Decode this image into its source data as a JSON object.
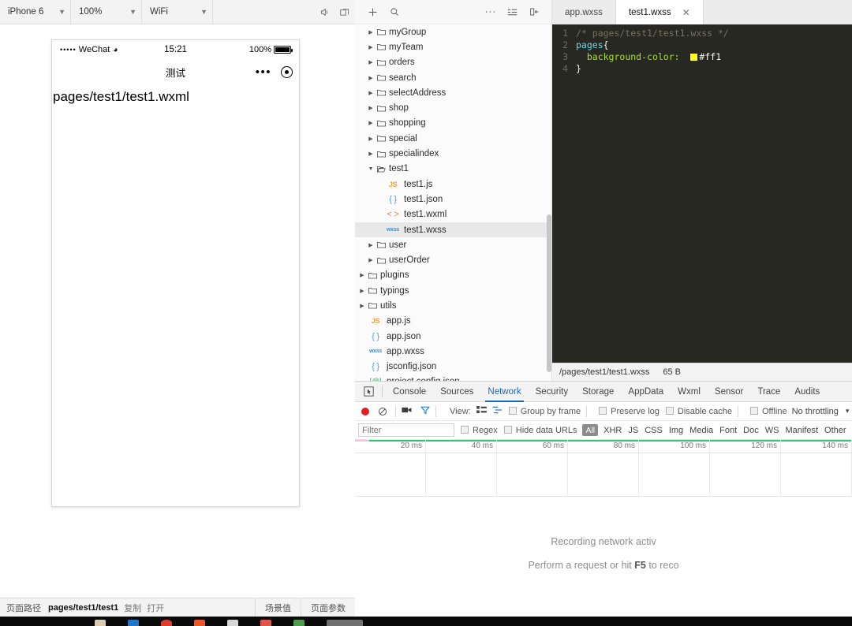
{
  "simulator": {
    "toolbar": {
      "device": "iPhone 6",
      "zoom": "100%",
      "network": "WiFi",
      "icons": [
        "volume-icon",
        "rotate-icon"
      ]
    },
    "phone": {
      "status": {
        "signal_dots": "•••••",
        "carrier": "WeChat",
        "wifi": "wifi-icon",
        "time": "15:21",
        "battery_percent": "100%"
      },
      "nav": {
        "title": "测试"
      },
      "content": "pages/test1/test1.wxml"
    },
    "status_bar": {
      "path_label": "页面路径",
      "path_value": "pages/test1/test1",
      "copy": "复制",
      "open": "打开",
      "scene_value": "场景值",
      "page_params": "页面参数"
    }
  },
  "files": {
    "toolbar": {
      "add": "add-icon",
      "search": "search-icon",
      "more": "more-icon",
      "outline": "outline-icon",
      "collapse": "collapse-icon"
    },
    "tree": [
      {
        "name": "myGroup",
        "type": "folder",
        "depth": 1,
        "open": false
      },
      {
        "name": "myTeam",
        "type": "folder",
        "depth": 1,
        "open": false
      },
      {
        "name": "orders",
        "type": "folder",
        "depth": 1,
        "open": false
      },
      {
        "name": "search",
        "type": "folder",
        "depth": 1,
        "open": false
      },
      {
        "name": "selectAddress",
        "type": "folder",
        "depth": 1,
        "open": false
      },
      {
        "name": "shop",
        "type": "folder",
        "depth": 1,
        "open": false
      },
      {
        "name": "shopping",
        "type": "folder",
        "depth": 1,
        "open": false
      },
      {
        "name": "special",
        "type": "folder",
        "depth": 1,
        "open": false
      },
      {
        "name": "specialindex",
        "type": "folder",
        "depth": 1,
        "open": false
      },
      {
        "name": "test1",
        "type": "folder",
        "depth": 1,
        "open": true
      },
      {
        "name": "test1.js",
        "type": "js",
        "depth": 2,
        "icon": "JS"
      },
      {
        "name": "test1.json",
        "type": "json",
        "depth": 2,
        "icon": "{ }"
      },
      {
        "name": "test1.wxml",
        "type": "wxml",
        "depth": 2,
        "icon": "< >"
      },
      {
        "name": "test1.wxss",
        "type": "wxss",
        "depth": 2,
        "icon": "wxss",
        "selected": true
      },
      {
        "name": "user",
        "type": "folder",
        "depth": 1,
        "open": false
      },
      {
        "name": "userOrder",
        "type": "folder",
        "depth": 1,
        "open": false
      },
      {
        "name": "plugins",
        "type": "folder",
        "depth": 0,
        "open": false
      },
      {
        "name": "typings",
        "type": "folder",
        "depth": 0,
        "open": false
      },
      {
        "name": "utils",
        "type": "folder",
        "depth": 0,
        "open": false
      },
      {
        "name": "app.js",
        "type": "js",
        "depth": 0,
        "icon": "JS"
      },
      {
        "name": "app.json",
        "type": "json",
        "depth": 0,
        "icon": "{ }"
      },
      {
        "name": "app.wxss",
        "type": "wxss",
        "depth": 0,
        "icon": "wxss"
      },
      {
        "name": "jsconfig.json",
        "type": "json",
        "depth": 0,
        "icon": "{ }"
      },
      {
        "name": "project.config.json",
        "type": "config",
        "depth": 0,
        "icon": "{@}"
      }
    ]
  },
  "editor": {
    "tabs": [
      {
        "label": "app.wxss",
        "active": false,
        "closable": false
      },
      {
        "label": "test1.wxss",
        "active": true,
        "closable": true
      }
    ],
    "close_icon": "✕",
    "lines": [
      {
        "no": "1",
        "kind": "comment",
        "text": "/* pages/test1/test1.wxss */"
      },
      {
        "no": "2",
        "kind": "selector",
        "selector": "pages",
        "brace": "{"
      },
      {
        "no": "3",
        "kind": "decl",
        "prop": "background-color:",
        "swatch": "#ffff22",
        "value": "#ff1"
      },
      {
        "no": "4",
        "kind": "close",
        "text": "}"
      }
    ],
    "footer": {
      "path": "/pages/test1/test1.wxss",
      "size": "65 B"
    }
  },
  "devtools": {
    "tabs": [
      {
        "label": "Console",
        "active": false
      },
      {
        "label": "Sources",
        "active": false
      },
      {
        "label": "Network",
        "active": true
      },
      {
        "label": "Security",
        "active": false
      },
      {
        "label": "Storage",
        "active": false
      },
      {
        "label": "AppData",
        "active": false
      },
      {
        "label": "Wxml",
        "active": false
      },
      {
        "label": "Sensor",
        "active": false
      },
      {
        "label": "Trace",
        "active": false
      },
      {
        "label": "Audits",
        "active": false
      }
    ],
    "network_toolbar": {
      "record": "record-icon",
      "clear": "clear-icon",
      "capture_screenshots": "camera-icon",
      "filter": "funnel-icon",
      "view_label": "View:",
      "view_list": "list-view-icon",
      "view_waterfall": "waterfall-view-icon",
      "group_by_frame": "Group by frame",
      "preserve_log": "Preserve log",
      "disable_cache": "Disable cache",
      "offline": "Offline",
      "throttling": "No throttling",
      "throttling_caret": "▾"
    },
    "filter_bar": {
      "placeholder": "Filter",
      "value": "",
      "regex": "Regex",
      "hide_data_urls": "Hide data URLs",
      "types": [
        "All",
        "XHR",
        "JS",
        "CSS",
        "Img",
        "Media",
        "Font",
        "Doc",
        "WS",
        "Manifest",
        "Other"
      ],
      "active_type": "All"
    },
    "timeline_ticks": [
      "20 ms",
      "40 ms",
      "60 ms",
      "80 ms",
      "100 ms",
      "120 ms",
      "140 ms"
    ],
    "empty_state": {
      "line1": "Recording network activ",
      "line2_pre": "Perform a request or hit ",
      "line2_key": "F5",
      "line2_post": " to reco"
    }
  },
  "colors": {
    "accent": "#1669c1",
    "record": "#e02020",
    "timeline_green": "#35c377",
    "swatch_yellow": "#ffff22"
  }
}
